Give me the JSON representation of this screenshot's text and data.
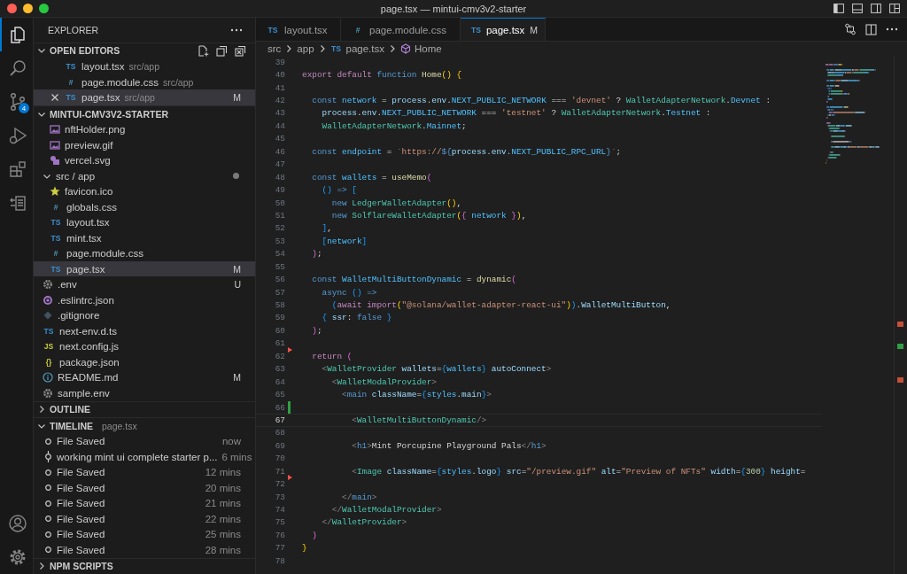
{
  "window": {
    "title": "page.tsx — mintui-cmv3v2-starter"
  },
  "activity_bar": {
    "items": [
      {
        "kind": "files",
        "selected": true
      },
      {
        "kind": "search",
        "selected": false
      },
      {
        "kind": "source-control",
        "selected": false,
        "badge": "4"
      },
      {
        "kind": "run-debug",
        "selected": false
      },
      {
        "kind": "extensions",
        "selected": false
      },
      {
        "kind": "remote",
        "selected": false
      }
    ],
    "bottom": [
      {
        "kind": "account"
      },
      {
        "kind": "settings"
      }
    ]
  },
  "sidebar": {
    "title": "EXPLORER",
    "open_editors": {
      "title": "OPEN EDITORS",
      "expanded": true,
      "items": [
        {
          "name": "layout.tsx",
          "path": "src/app",
          "glyph": "TS",
          "kind": "ts",
          "selected": false
        },
        {
          "name": "page.module.css",
          "path": "src/app",
          "glyph": "#",
          "kind": "css",
          "selected": false
        },
        {
          "name": "page.tsx",
          "path": "src/app",
          "glyph": "TS",
          "kind": "ts",
          "selected": true,
          "badge": "M"
        }
      ]
    },
    "project": {
      "title": "MINTUI-CMV3V2-STARTER",
      "expanded": true,
      "tree": [
        {
          "children": [
            {
              "name": "nftHolder.png",
              "kind": "image",
              "selected": false
            },
            {
              "name": "preview.gif",
              "kind": "image",
              "selected": false
            },
            {
              "name": "vercel.svg",
              "kind": "svg",
              "selected": false
            }
          ]
        },
        {
          "name": "src / app",
          "kind": "folder",
          "expanded": true,
          "modified": true,
          "selected": false,
          "children": [
            {
              "name": "favicon.ico",
              "kind": "star",
              "selected": false
            },
            {
              "name": "globals.css",
              "kind": "css",
              "glyph": "#",
              "selected": false
            },
            {
              "name": "layout.tsx",
              "kind": "ts",
              "glyph": "TS",
              "selected": false
            },
            {
              "name": "mint.tsx",
              "kind": "ts",
              "glyph": "TS",
              "selected": false
            },
            {
              "name": "page.module.css",
              "kind": "css",
              "glyph": "#",
              "selected": false
            },
            {
              "name": "page.tsx",
              "kind": "ts",
              "glyph": "TS",
              "selected": true,
              "badge": "M"
            }
          ]
        },
        {
          "name": ".env",
          "kind": "gear",
          "selected": false,
          "badge": "U"
        },
        {
          "name": ".eslintrc.json",
          "kind": "eslint",
          "selected": false
        },
        {
          "name": ".gitignore",
          "kind": "git",
          "selected": false
        },
        {
          "name": "next-env.d.ts",
          "kind": "ts",
          "glyph": "TS",
          "selected": false
        },
        {
          "name": "next.config.js",
          "kind": "js",
          "glyph": "JS",
          "selected": false
        },
        {
          "name": "package.json",
          "kind": "json",
          "glyph": "{}",
          "selected": false
        },
        {
          "name": "README.md",
          "kind": "info",
          "selected": false,
          "badge": "M"
        },
        {
          "name": "sample.env",
          "kind": "gear",
          "selected": false
        }
      ]
    },
    "outline": {
      "title": "OUTLINE",
      "expanded": false
    },
    "timeline": {
      "title": "TIMELINE",
      "subtitle": "page.tsx",
      "expanded": true,
      "items": [
        {
          "label": "File Saved",
          "time": "now",
          "kind": "save"
        },
        {
          "label": "working mint ui complete starter p...",
          "time": "6 mins",
          "kind": "commit"
        },
        {
          "label": "File Saved",
          "time": "12 mins",
          "kind": "save"
        },
        {
          "label": "File Saved",
          "time": "20 mins",
          "kind": "save"
        },
        {
          "label": "File Saved",
          "time": "21 mins",
          "kind": "save"
        },
        {
          "label": "File Saved",
          "time": "22 mins",
          "kind": "save"
        },
        {
          "label": "File Saved",
          "time": "25 mins",
          "kind": "save"
        },
        {
          "label": "File Saved",
          "time": "28 mins",
          "kind": "save"
        }
      ]
    },
    "npm_scripts": {
      "title": "NPM SCRIPTS",
      "expanded": false
    }
  },
  "tabs": [
    {
      "label": "layout.tsx",
      "glyph": "TS",
      "kind": "ts",
      "selected": false
    },
    {
      "label": "page.module.css",
      "glyph": "#",
      "kind": "css",
      "selected": false
    },
    {
      "label": "page.tsx",
      "glyph": "TS",
      "kind": "ts",
      "selected": true,
      "badge": "M"
    }
  ],
  "breadcrumbs": [
    {
      "label": "src"
    },
    {
      "label": "app"
    },
    {
      "label": "page.tsx",
      "kind": "ts",
      "glyph": "TS"
    },
    {
      "label": "Home",
      "kind": "symbol"
    }
  ],
  "editor": {
    "lines": [
      {
        "number": "39"
      },
      {
        "number": "40",
        "tokens": [
          {
            "text": "export ",
            "kind": "kw2"
          },
          {
            "text": "default ",
            "kind": "kw2"
          },
          {
            "text": "function ",
            "kind": "kw"
          },
          {
            "text": "Home",
            "kind": "fn"
          },
          {
            "text": "() ",
            "kind": "b1"
          },
          {
            "text": "{",
            "kind": "b1"
          }
        ]
      },
      {
        "number": "41"
      },
      {
        "number": "42",
        "tokens": [
          {
            "text": "  const ",
            "kind": "kw"
          },
          {
            "text": "network",
            "kind": "c"
          },
          {
            "text": " = ",
            "kind": "p"
          },
          {
            "text": "process",
            "kind": "v"
          },
          {
            "text": ".",
            "kind": "p"
          },
          {
            "text": "env",
            "kind": "v"
          },
          {
            "text": ".",
            "kind": "p"
          },
          {
            "text": "NEXT_PUBLIC_NETWORK",
            "kind": "c"
          },
          {
            "text": " === ",
            "kind": "p"
          },
          {
            "text": "'devnet'",
            "kind": "s"
          },
          {
            "text": " ? ",
            "kind": "p"
          },
          {
            "text": "WalletAdapterNetwork",
            "kind": "cls"
          },
          {
            "text": ".",
            "kind": "p"
          },
          {
            "text": "Devnet",
            "kind": "c"
          },
          {
            "text": " :",
            "kind": "p"
          }
        ]
      },
      {
        "number": "43",
        "tokens": [
          {
            "text": "    process",
            "kind": "v"
          },
          {
            "text": ".",
            "kind": "p"
          },
          {
            "text": "env",
            "kind": "v"
          },
          {
            "text": ".",
            "kind": "p"
          },
          {
            "text": "NEXT_PUBLIC_NETWORK",
            "kind": "c"
          },
          {
            "text": " === ",
            "kind": "p"
          },
          {
            "text": "'testnet'",
            "kind": "s"
          },
          {
            "text": " ? ",
            "kind": "p"
          },
          {
            "text": "WalletAdapterNetwork",
            "kind": "cls"
          },
          {
            "text": ".",
            "kind": "p"
          },
          {
            "text": "Testnet",
            "kind": "c"
          },
          {
            "text": " :",
            "kind": "p"
          }
        ]
      },
      {
        "number": "44",
        "tokens": [
          {
            "text": "    WalletAdapterNetwork",
            "kind": "cls"
          },
          {
            "text": ".",
            "kind": "p"
          },
          {
            "text": "Mainnet",
            "kind": "c"
          },
          {
            "text": ";",
            "kind": "p"
          }
        ]
      },
      {
        "number": "45"
      },
      {
        "number": "46",
        "tokens": [
          {
            "text": "  const ",
            "kind": "kw"
          },
          {
            "text": "endpoint",
            "kind": "c"
          },
          {
            "text": " = ",
            "kind": "p"
          },
          {
            "text": "`https://",
            "kind": "s"
          },
          {
            "text": "${",
            "kind": "kw"
          },
          {
            "text": "process.env.",
            "kind": "v"
          },
          {
            "text": "NEXT_PUBLIC_RPC_URL",
            "kind": "c"
          },
          {
            "text": "}",
            "kind": "kw"
          },
          {
            "text": "`",
            "kind": "s"
          },
          {
            "text": ";",
            "kind": "p"
          }
        ]
      },
      {
        "number": "47"
      },
      {
        "number": "48",
        "tokens": [
          {
            "text": "  const ",
            "kind": "kw"
          },
          {
            "text": "wallets",
            "kind": "c"
          },
          {
            "text": " = ",
            "kind": "p"
          },
          {
            "text": "useMemo",
            "kind": "fn"
          },
          {
            "text": "(",
            "kind": "b2"
          }
        ]
      },
      {
        "number": "49",
        "tokens": [
          {
            "text": "    () ",
            "kind": "b3"
          },
          {
            "text": "=> ",
            "kind": "kw"
          },
          {
            "text": "[",
            "kind": "b3"
          }
        ]
      },
      {
        "number": "50",
        "tokens": [
          {
            "text": "      new ",
            "kind": "kw"
          },
          {
            "text": "LedgerWalletAdapter",
            "kind": "cls"
          },
          {
            "text": "()",
            "kind": "b1"
          },
          {
            "text": ",",
            "kind": "p"
          }
        ]
      },
      {
        "number": "51",
        "tokens": [
          {
            "text": "      new ",
            "kind": "kw"
          },
          {
            "text": "SolflareWalletAdapter",
            "kind": "cls"
          },
          {
            "text": "(",
            "kind": "b1"
          },
          {
            "text": "{ ",
            "kind": "b2"
          },
          {
            "text": "network ",
            "kind": "c"
          },
          {
            "text": "}",
            "kind": "b2"
          },
          {
            "text": ")",
            "kind": "b1"
          },
          {
            "text": ",",
            "kind": "p"
          }
        ]
      },
      {
        "number": "52",
        "tokens": [
          {
            "text": "    ]",
            "kind": "b3"
          },
          {
            "text": ",",
            "kind": "p"
          }
        ]
      },
      {
        "number": "53",
        "tokens": [
          {
            "text": "    [",
            "kind": "b3"
          },
          {
            "text": "network",
            "kind": "c"
          },
          {
            "text": "]",
            "kind": "b3"
          }
        ]
      },
      {
        "number": "54",
        "tokens": [
          {
            "text": "  )",
            "kind": "b2"
          },
          {
            "text": ";",
            "kind": "p"
          }
        ]
      },
      {
        "number": "55"
      },
      {
        "number": "56",
        "tokens": [
          {
            "text": "  const ",
            "kind": "kw"
          },
          {
            "text": "WalletMultiButtonDynamic",
            "kind": "c"
          },
          {
            "text": " = ",
            "kind": "p"
          },
          {
            "text": "dynamic",
            "kind": "fn"
          },
          {
            "text": "(",
            "kind": "b2"
          }
        ]
      },
      {
        "number": "57",
        "tokens": [
          {
            "text": "    async ",
            "kind": "kw"
          },
          {
            "text": "() ",
            "kind": "b3"
          },
          {
            "text": "=>",
            "kind": "kw"
          }
        ]
      },
      {
        "number": "58",
        "tokens": [
          {
            "text": "      (",
            "kind": "b3"
          },
          {
            "text": "await ",
            "kind": "kw2"
          },
          {
            "text": "import",
            "kind": "kw2"
          },
          {
            "text": "(",
            "kind": "b1"
          },
          {
            "text": "\"@solana/wallet-adapter-react-ui\"",
            "kind": "s"
          },
          {
            "text": ")",
            "kind": "b1"
          },
          {
            "text": ")",
            "kind": "b3"
          },
          {
            "text": ".",
            "kind": "p"
          },
          {
            "text": "WalletMultiButton",
            "kind": "v"
          },
          {
            "text": ",",
            "kind": "p"
          }
        ]
      },
      {
        "number": "59",
        "tokens": [
          {
            "text": "    { ",
            "kind": "b3"
          },
          {
            "text": "ssr",
            "kind": "v"
          },
          {
            "text": ": ",
            "kind": "p"
          },
          {
            "text": "false ",
            "kind": "kw"
          },
          {
            "text": "}",
            "kind": "b3"
          }
        ]
      },
      {
        "number": "60",
        "tokens": [
          {
            "text": "  )",
            "kind": "b2"
          },
          {
            "text": ";",
            "kind": "p"
          }
        ]
      },
      {
        "number": "61"
      },
      {
        "number": "62",
        "deleted": true,
        "tokens": [
          {
            "text": "  return ",
            "kind": "kw2"
          },
          {
            "text": "(",
            "kind": "b2"
          }
        ]
      },
      {
        "number": "63",
        "tokens": [
          {
            "text": "    <",
            "kind": "tag"
          },
          {
            "text": "WalletProvider ",
            "kind": "cls"
          },
          {
            "text": "wallets",
            "kind": "v"
          },
          {
            "text": "=",
            "kind": "p"
          },
          {
            "text": "{",
            "kind": "b3"
          },
          {
            "text": "wallets",
            "kind": "c"
          },
          {
            "text": "} ",
            "kind": "b3"
          },
          {
            "text": "autoConnect",
            "kind": "v"
          },
          {
            "text": ">",
            "kind": "tag"
          }
        ]
      },
      {
        "number": "64",
        "tokens": [
          {
            "text": "      <",
            "kind": "tag"
          },
          {
            "text": "WalletModalProvider",
            "kind": "cls"
          },
          {
            "text": ">",
            "kind": "tag"
          }
        ]
      },
      {
        "number": "65",
        "tokens": [
          {
            "text": "        <",
            "kind": "tag"
          },
          {
            "text": "main ",
            "kind": "kw"
          },
          {
            "text": "className",
            "kind": "v"
          },
          {
            "text": "=",
            "kind": "p"
          },
          {
            "text": "{",
            "kind": "b3"
          },
          {
            "text": "styles",
            "kind": "c"
          },
          {
            "text": ".",
            "kind": "p"
          },
          {
            "text": "main",
            "kind": "v"
          },
          {
            "text": "}",
            "kind": "b3"
          },
          {
            "text": ">",
            "kind": "tag"
          }
        ]
      },
      {
        "number": "66",
        "added": true
      },
      {
        "number": "67",
        "current": true,
        "tokens": [
          {
            "text": "          <",
            "kind": "tag"
          },
          {
            "text": "WalletMultiButtonDynamic",
            "kind": "cls"
          },
          {
            "text": "/>",
            "kind": "tag"
          }
        ]
      },
      {
        "number": "68"
      },
      {
        "number": "69",
        "tokens": [
          {
            "text": "          <",
            "kind": "tag"
          },
          {
            "text": "h1",
            "kind": "kw"
          },
          {
            "text": ">",
            "kind": "tag"
          },
          {
            "text": "Mint Porcupine Playground Pals",
            "kind": "p"
          },
          {
            "text": "</",
            "kind": "tag"
          },
          {
            "text": "h1",
            "kind": "kw"
          },
          {
            "text": ">",
            "kind": "tag"
          }
        ]
      },
      {
        "number": "70"
      },
      {
        "number": "71",
        "tokens": [
          {
            "text": "          <",
            "kind": "tag"
          },
          {
            "text": "Image ",
            "kind": "cls"
          },
          {
            "text": "className",
            "kind": "v"
          },
          {
            "text": "=",
            "kind": "p"
          },
          {
            "text": "{",
            "kind": "b3"
          },
          {
            "text": "styles",
            "kind": "c"
          },
          {
            "text": ".",
            "kind": "p"
          },
          {
            "text": "logo",
            "kind": "v"
          },
          {
            "text": "} ",
            "kind": "b3"
          },
          {
            "text": "src",
            "kind": "v"
          },
          {
            "text": "=",
            "kind": "p"
          },
          {
            "text": "\"/preview.gif\" ",
            "kind": "s"
          },
          {
            "text": "alt",
            "kind": "v"
          },
          {
            "text": "=",
            "kind": "p"
          },
          {
            "text": "\"Preview of NFTs\" ",
            "kind": "s"
          },
          {
            "text": "width",
            "kind": "v"
          },
          {
            "text": "=",
            "kind": "p"
          },
          {
            "text": "{",
            "kind": "b3"
          },
          {
            "text": "300",
            "kind": "num"
          },
          {
            "text": "} ",
            "kind": "b3"
          },
          {
            "text": "height",
            "kind": "v"
          },
          {
            "text": "=",
            "kind": "p"
          }
        ]
      },
      {
        "number": "72",
        "deleted": true
      },
      {
        "number": "73",
        "tokens": [
          {
            "text": "        </",
            "kind": "tag"
          },
          {
            "text": "main",
            "kind": "kw"
          },
          {
            "text": ">",
            "kind": "tag"
          }
        ]
      },
      {
        "number": "74",
        "tokens": [
          {
            "text": "      </",
            "kind": "tag"
          },
          {
            "text": "WalletModalProvider",
            "kind": "cls"
          },
          {
            "text": ">",
            "kind": "tag"
          }
        ]
      },
      {
        "number": "75",
        "tokens": [
          {
            "text": "    </",
            "kind": "tag"
          },
          {
            "text": "WalletProvider",
            "kind": "cls"
          },
          {
            "text": ">",
            "kind": "tag"
          }
        ]
      },
      {
        "number": "76",
        "tokens": [
          {
            "text": "  )",
            "kind": "b2"
          }
        ]
      },
      {
        "number": "77",
        "tokens": [
          {
            "text": "}",
            "kind": "b1"
          }
        ]
      },
      {
        "number": "78"
      }
    ]
  }
}
